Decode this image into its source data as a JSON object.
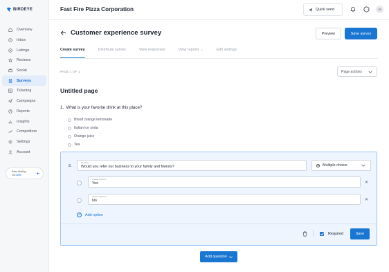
{
  "brand": {
    "name": "BIRDEYE",
    "accent": "#1976d2"
  },
  "sidebar": {
    "items": [
      {
        "label": "Overview",
        "icon": "home-icon"
      },
      {
        "label": "Inbox",
        "icon": "inbox-icon"
      },
      {
        "label": "Listings",
        "icon": "listings-icon"
      },
      {
        "label": "Reviews",
        "icon": "star-icon"
      },
      {
        "label": "Social",
        "icon": "social-icon"
      },
      {
        "label": "Surveys",
        "icon": "survey-icon",
        "active": true
      },
      {
        "label": "Ticketing",
        "icon": "ticket-icon"
      },
      {
        "label": "Campaigns",
        "icon": "send-icon"
      },
      {
        "label": "Reports",
        "icon": "reports-icon"
      },
      {
        "label": "Insights",
        "icon": "insights-icon"
      },
      {
        "label": "Competitors",
        "icon": "trend-icon"
      },
      {
        "label": "Settings",
        "icon": "gear-icon"
      },
      {
        "label": "Account",
        "icon": "user-icon"
      }
    ],
    "refer": {
      "line1": "Refer BirdEye",
      "line2_prefix": "Get ",
      "line2_amount": "$250"
    }
  },
  "topbar": {
    "company": "Fast Fire Pizza Corporation",
    "quick_send": "Quick send",
    "avatar_initials": "JS"
  },
  "header": {
    "title": "Customer experience survey",
    "preview": "Preview",
    "save_survey": "Save survey"
  },
  "tabs": [
    "Create survey",
    "Distribute survey",
    "View responses",
    "View reports",
    "Edit settings"
  ],
  "page": {
    "indicator": "PAGE 1 OF 1",
    "actions": "Page actions",
    "title": "Untitled page"
  },
  "question1": {
    "number": "1.",
    "text": "What is your favorite drink at this place?",
    "options": [
      "Blood orange lemonade",
      "Italian ice soda",
      "Orange juice",
      "Tea"
    ]
  },
  "question2": {
    "number": "2.",
    "question_label": "Question",
    "question_value": "Would you refer our business to your family and friends?",
    "type": "Multiple choice",
    "choices": [
      {
        "label": "Answer choice 1",
        "value": "Yes"
      },
      {
        "label": "Answer choice 2",
        "value": "No"
      }
    ],
    "add_option": "Add option",
    "required": "Required",
    "save": "Save"
  },
  "add_question": "Add question"
}
